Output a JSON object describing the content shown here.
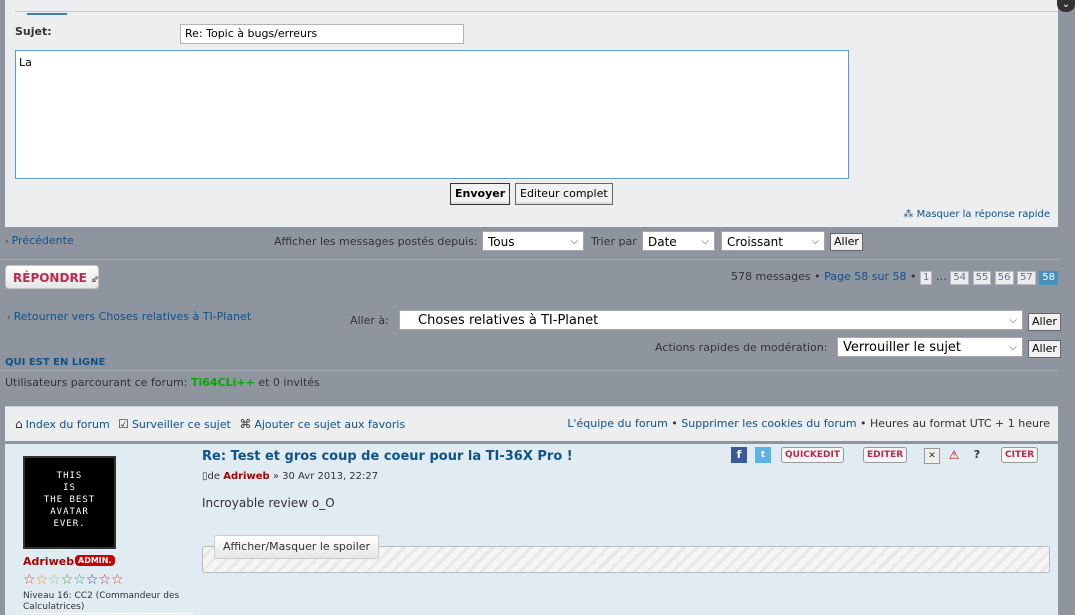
{
  "quick_reply": {
    "subject_label": "Sujet:",
    "subject_value": "Re: Topic à bugs/erreurs",
    "message_value": "La",
    "send_label": "Envoyer",
    "full_editor_label": "Editeur complet",
    "hide_label": "Masquer la réponse rapide"
  },
  "topic_nav": {
    "previous_label": "Précédente",
    "show_since_label": "Afficher les messages postés depuis:",
    "since_value": "Tous",
    "sort_label": "Trier par",
    "sort_value": "Date",
    "order_value": "Croissant",
    "go_label": "Aller"
  },
  "actions": {
    "reply_label": "RÉPONDRE",
    "messages_count": "578 messages",
    "page_info": "Page 58 sur 58",
    "pages": [
      "1",
      "…",
      "54",
      "55",
      "56",
      "57",
      "58"
    ],
    "current_page": "58"
  },
  "jump": {
    "back_label": "Retourner vers Choses relatives à TI-Planet",
    "jump_label": "Aller à:",
    "jump_value": "Choses relatives à TI-Planet",
    "go_label": "Aller",
    "mod_label": "Actions rapides de modération:",
    "mod_value": "Verrouiller le sujet"
  },
  "online": {
    "heading": "QUI EST EN LIGNE",
    "prefix": "Utilisateurs parcourant ce forum:",
    "user": "Ti64CLi++",
    "suffix": "et 0 invités"
  },
  "footer": {
    "index_label": "Index du forum",
    "watch_label": "Surveiller ce sujet",
    "bookmark_label": "Ajouter ce sujet aux favoris",
    "team_label": "L'équipe du forum",
    "cookies_label": "Supprimer les cookies du forum",
    "timezone_label": "Heures au format UTC + 1 heure"
  },
  "post": {
    "title": "Re: Test et gros coup de coeur pour la TI-36X Pro !",
    "meta_prefix": "de",
    "author": "Adriweb",
    "meta_date": "» 30 Avr 2013, 22:27",
    "body": "Incroyable review o_O",
    "spoiler_label": "Afficher/Masquer le spoiler",
    "avatar_lines": [
      "THIS",
      "IS",
      "THE BEST",
      "AVATAR",
      "EVER."
    ],
    "username": "Adriweb",
    "badge": "ADMIN.",
    "rank": "Niveau 16: CC2 (Commandeur des Calculatrices)",
    "quickedit_label": "QUICKEDIT",
    "edit_label": "EDITER",
    "quote_label": "CITER"
  }
}
